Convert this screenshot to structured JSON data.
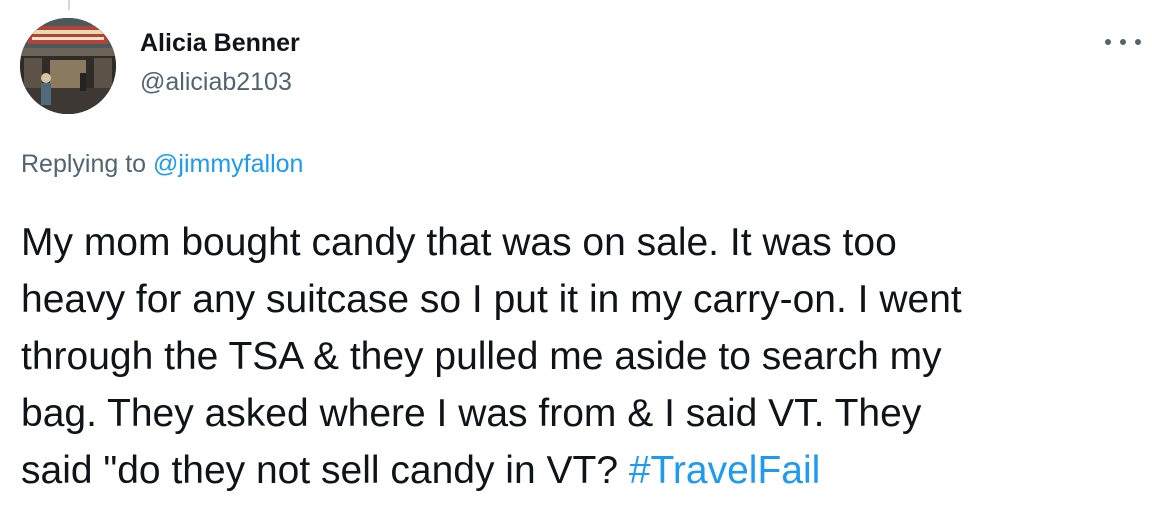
{
  "author": {
    "name": "Alicia Benner",
    "handle": "@aliciab2103",
    "avatar_icon": "profile-photo"
  },
  "more_icon": "more-options-icon",
  "reply": {
    "prefix": "Replying to ",
    "mention": "@jimmyfallon"
  },
  "tweet": {
    "lines": [
      "My mom bought candy that was on sale. It was too",
      "heavy for any suitcase so I put it in my carry-on. I went",
      "through the TSA & they pulled me aside to search my",
      "bag. They asked where I was from & I said VT. They"
    ],
    "last_line_text": "said \"do they not sell candy in VT? ",
    "hashtag": "#TravelFail"
  },
  "colors": {
    "link": "#1d9bf0",
    "secondary": "#536471",
    "primary": "#0f1419"
  }
}
